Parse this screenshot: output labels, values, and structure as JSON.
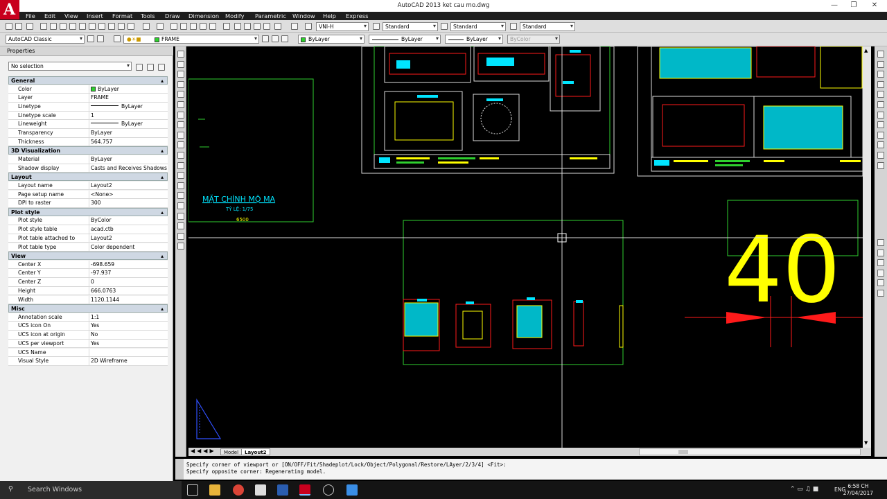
{
  "window": {
    "title": "AutoCAD 2013    ket cau mo.dwg"
  },
  "menu": [
    "File",
    "Edit",
    "View",
    "Insert",
    "Format",
    "Tools",
    "Draw",
    "Dimension",
    "Modify",
    "Parametric",
    "Window",
    "Help",
    "Express"
  ],
  "toolbar1": {
    "text_style": "VNI-H",
    "dim_style": "Standard",
    "table_style": "Standard",
    "multileader_style": "Standard"
  },
  "toolbar2": {
    "workspace": "AutoCAD Classic",
    "layer": "FRAME",
    "color": "ByLayer",
    "linetype": "ByLayer",
    "lineweight": "ByLayer",
    "plotstyle": "ByColor"
  },
  "properties": {
    "header": "Properties",
    "selection": "No selection",
    "sections": [
      {
        "title": "General",
        "rows": [
          {
            "k": "Color",
            "v": "ByLayer"
          },
          {
            "k": "Layer",
            "v": "FRAME"
          },
          {
            "k": "Linetype",
            "v": "ByLayer"
          },
          {
            "k": "Linetype scale",
            "v": "1"
          },
          {
            "k": "Lineweight",
            "v": "ByLayer"
          },
          {
            "k": "Transparency",
            "v": "ByLayer"
          },
          {
            "k": "Thickness",
            "v": "564.757"
          }
        ]
      },
      {
        "title": "3D Visualization",
        "rows": [
          {
            "k": "Material",
            "v": "ByLayer"
          },
          {
            "k": "Shadow display",
            "v": "Casts and Receives Shadows"
          }
        ]
      },
      {
        "title": "Layout",
        "rows": [
          {
            "k": "Layout name",
            "v": "Layout2"
          },
          {
            "k": "Page setup name",
            "v": "<None>"
          },
          {
            "k": "DPI to raster",
            "v": "300"
          }
        ]
      },
      {
        "title": "Plot style",
        "rows": [
          {
            "k": "Plot style",
            "v": "ByColor"
          },
          {
            "k": "Plot style table",
            "v": "acad.ctb"
          },
          {
            "k": "Plot table attached to",
            "v": "Layout2"
          },
          {
            "k": "Plot table type",
            "v": "Color dependent"
          }
        ]
      },
      {
        "title": "View",
        "rows": [
          {
            "k": "Center X",
            "v": "-698.659"
          },
          {
            "k": "Center Y",
            "v": "-97.937"
          },
          {
            "k": "Center Z",
            "v": "0"
          },
          {
            "k": "Height",
            "v": "666.0763"
          },
          {
            "k": "Width",
            "v": "1120.1144"
          }
        ]
      },
      {
        "title": "Misc",
        "rows": [
          {
            "k": "Annotation scale",
            "v": "1:1"
          },
          {
            "k": "UCS icon On",
            "v": "Yes"
          },
          {
            "k": "UCS icon at origin",
            "v": "No"
          },
          {
            "k": "UCS per viewport",
            "v": "Yes"
          },
          {
            "k": "UCS Name",
            "v": ""
          },
          {
            "k": "Visual Style",
            "v": "2D Wireframe"
          }
        ]
      }
    ]
  },
  "drawing": {
    "title": "MẶT CHÍNH MỘ MA",
    "scale": "TỶ LỆ: 1/75",
    "dim": "6500",
    "big_number": "40"
  },
  "tabs": {
    "model": "Model",
    "layout": "Layout2"
  },
  "command": {
    "line1": "Specify corner of viewport or [ON/OFF/Fit/Shadeplot/Lock/Object/Polygonal/Restore/LAyer/2/3/4] <Fit>:",
    "line2": "Specify opposite corner: Regenerating model."
  },
  "taskbar": {
    "search": "Search Windows",
    "time": "6:58 CH",
    "date": "27/04/2017",
    "lang": "ENG"
  },
  "colors": {
    "green": "#2fd02f",
    "cyan": "#00e5ff",
    "yellow": "#ffff00",
    "red": "#ff1a1a"
  }
}
